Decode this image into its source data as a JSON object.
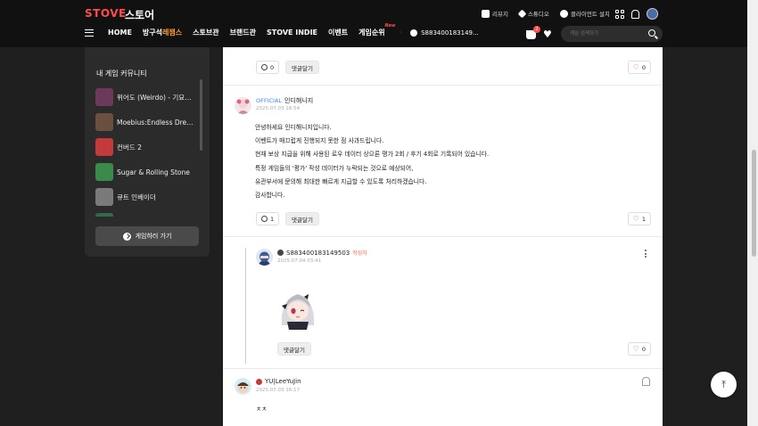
{
  "header": {
    "logo": "STOVE",
    "logo_kr": "스토어",
    "top_links": [
      {
        "label": "리뷰지",
        "icon": "review-icon"
      },
      {
        "label": "스튜디오",
        "icon": "studio-icon"
      },
      {
        "label": "클라이언트 설치",
        "icon": "play-icon"
      }
    ],
    "nav": {
      "home": "HOME",
      "discount_prefix": "방구석",
      "discount_highlight": "레잼스",
      "store": "스토브관",
      "brand": "브랜드관",
      "indie": "STOVE INDIE",
      "event": "이벤트",
      "ranking": "게임순위",
      "ranking_new": "New",
      "user": "S883400183149..."
    },
    "cart_count": "2",
    "search_placeholder": "게임 검색하기"
  },
  "sidebar": {
    "title": "내 게임 커뮤니티",
    "games": [
      {
        "name": "위어도 (Weirdo) - 기묘한...",
        "color": "#6b3a5a"
      },
      {
        "name": "Moebius:Endless Dream",
        "color": "#6b5040"
      },
      {
        "name": "컨버드 2",
        "color": "#c23a3a"
      },
      {
        "name": "Sugar & Rolling Stone",
        "color": "#3a8a4a"
      },
      {
        "name": "큐트 인베이더",
        "color": "#7a7a7a"
      },
      {
        "name": "",
        "color": "#2f6a4a"
      }
    ],
    "button_label": "게임하러 가기"
  },
  "posts": {
    "top_comment_count": "0",
    "top_reply_label": "댓글달기",
    "top_like_count": "0",
    "official": {
      "badge": "OFFICIAL",
      "name": "인디해니지",
      "date": "2025.07.03 18:54",
      "lines": [
        "안녕하세요 인디해니지입니다.",
        "이벤트가 매끄럽게 진행되지 못한 점 사과드립니다.",
        "현재 보상 지급을 위해 사용된 로우 데이터 상으론 평가 2회 / 후기 4회로 기록되어 있습니다.",
        "특정 게임들의 '평가' 작성 데이터가 누락되는 것으로 예상되어,",
        "유관부서에 문의해 최대한 빠르게 지급할 수 있도록 처리하겠습니다.",
        "감사합니다."
      ],
      "comment_count": "1",
      "reply_label": "댓글달기",
      "like_count": "1"
    },
    "reply": {
      "name": "S883400183149503",
      "writer_tag": "작성자",
      "date": "2025.07.04 03:41",
      "reply_label": "댓글달기",
      "like_count": "0"
    },
    "comment": {
      "name": "YU|LeeYuJin",
      "date": "2025.07.03 16:17",
      "text": "ㅊㅊ"
    }
  },
  "colors": {
    "accent": "#ff4b4b",
    "highlight": "#ff9e2c",
    "official": "#3d8bff"
  }
}
